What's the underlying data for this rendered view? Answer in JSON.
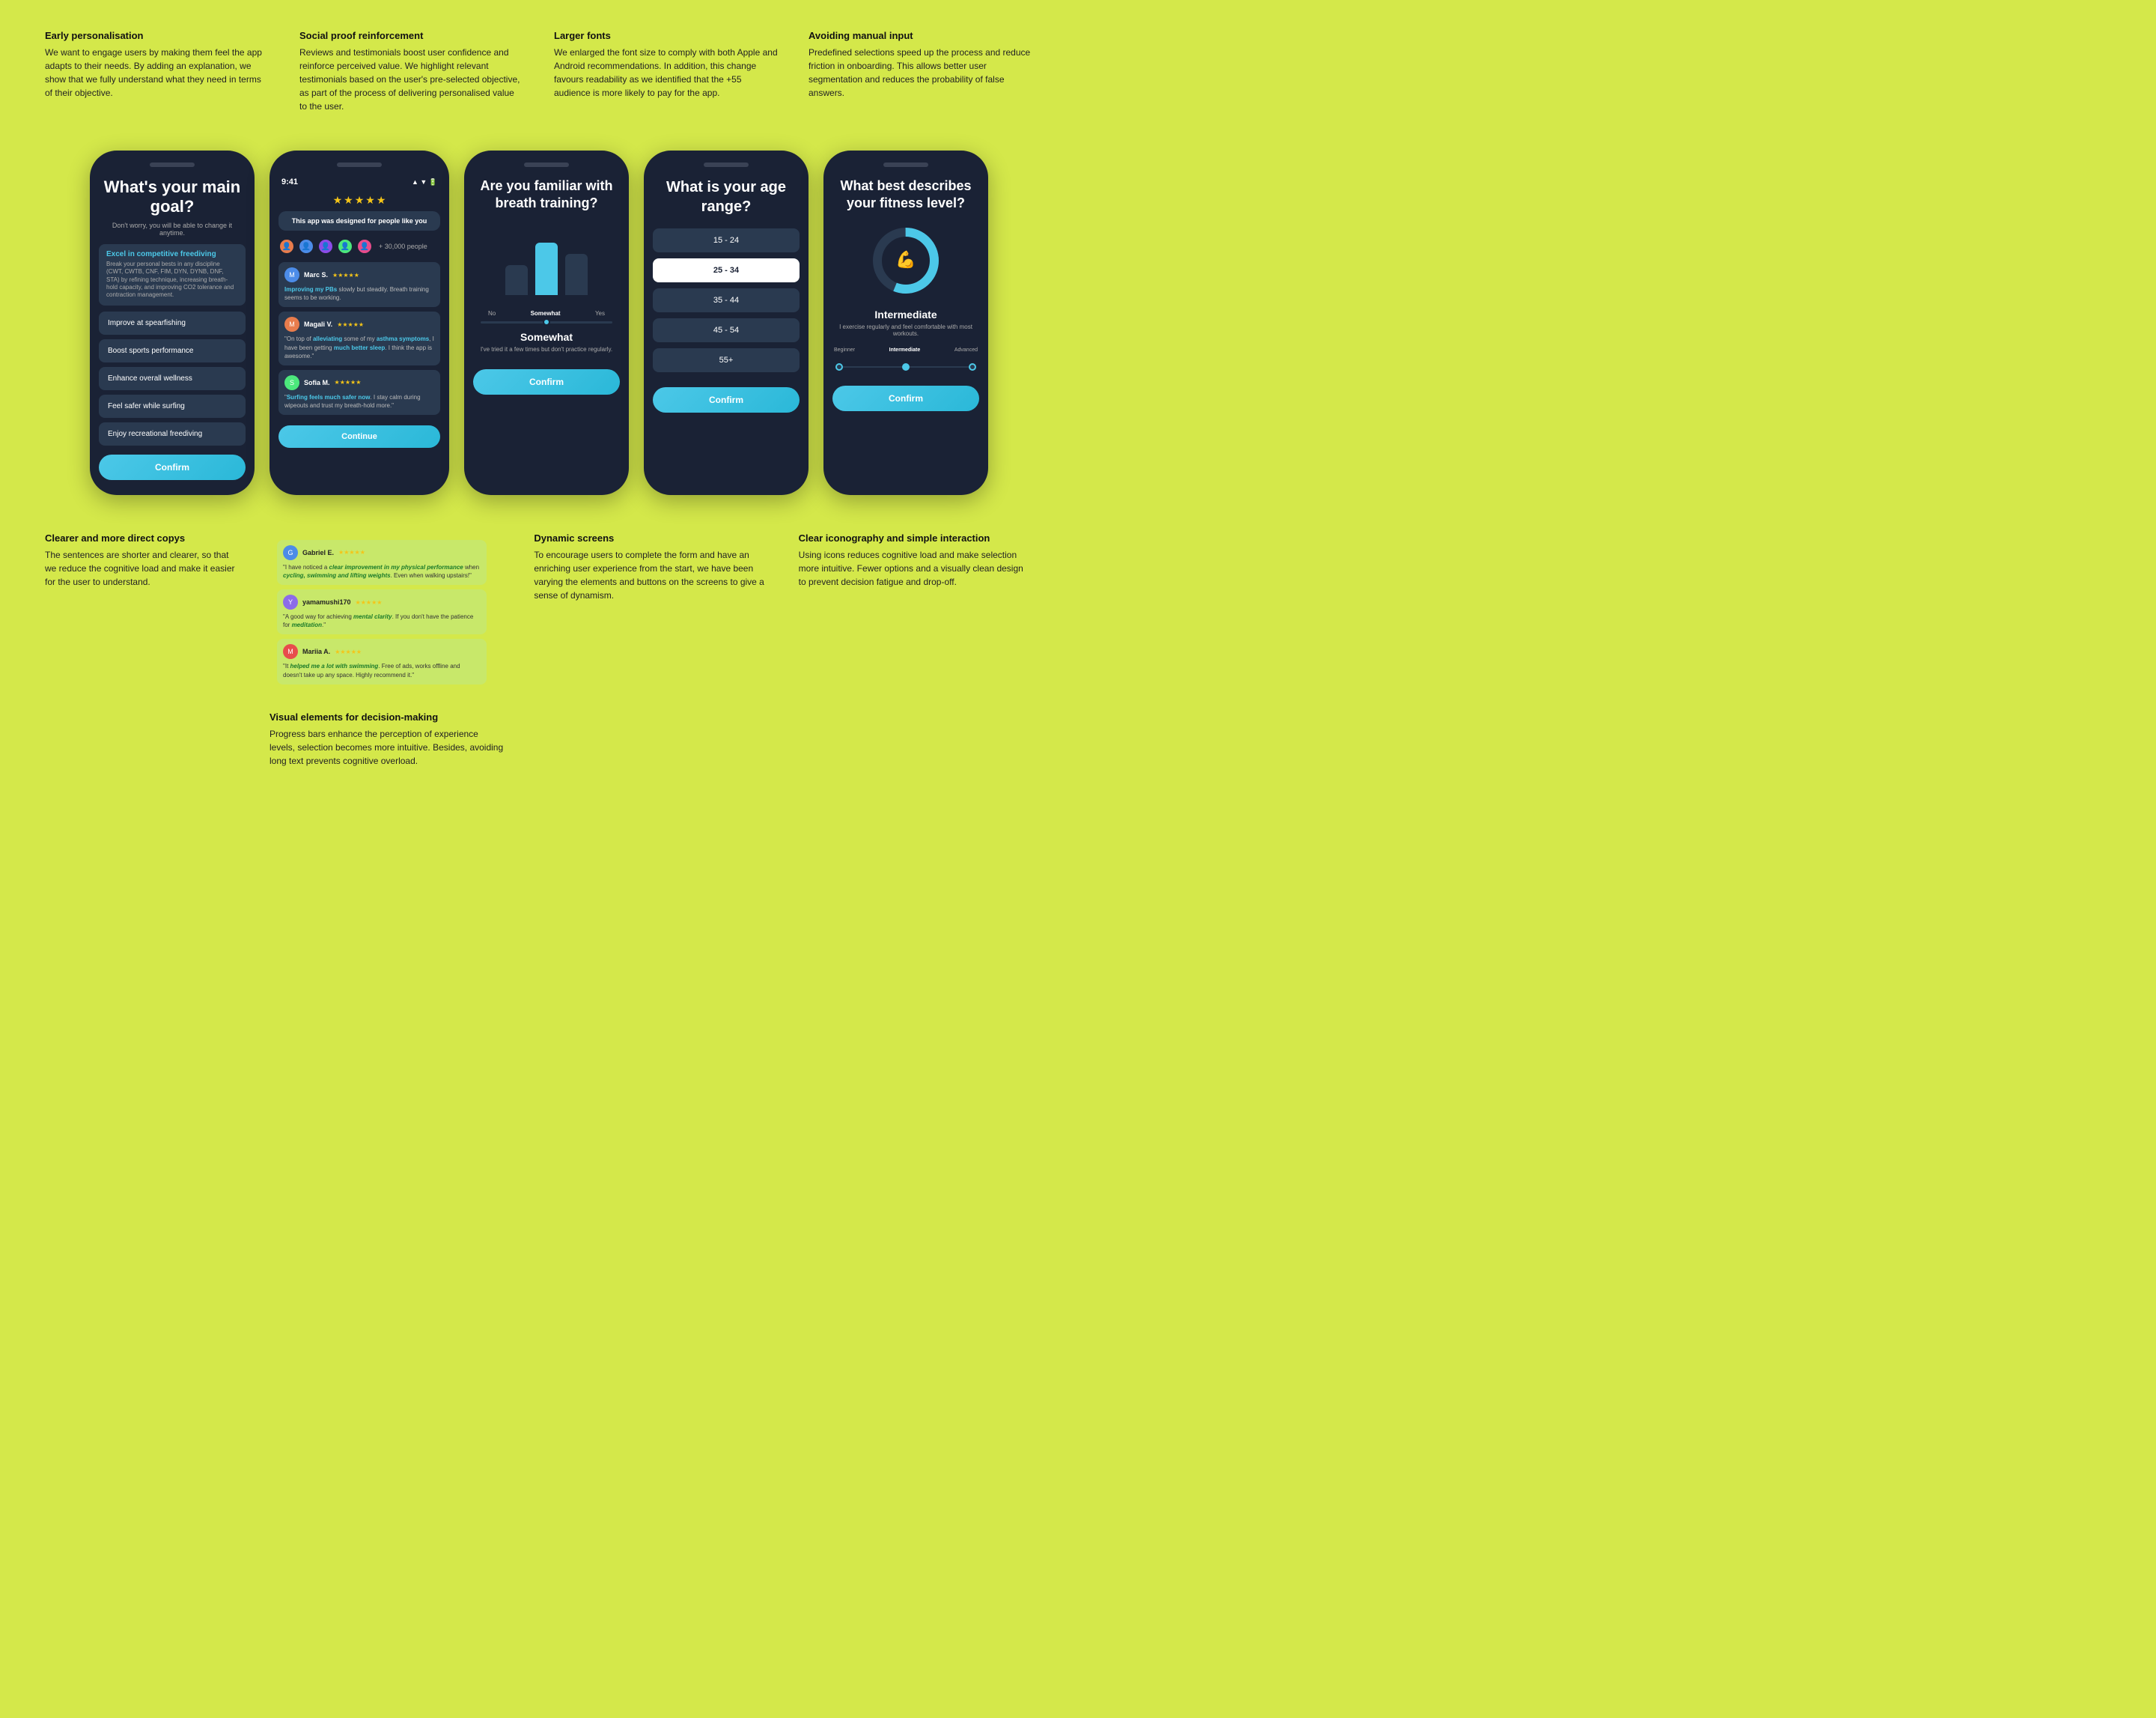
{
  "top_annotations": [
    {
      "id": "early-personalisation",
      "title": "Early personalisation",
      "text": "We want to engage users by making them feel the app adapts to their needs. By adding an explanation, we show that we fully understand what they need in terms of their objective."
    },
    {
      "id": "social-proof",
      "title": "Social proof reinforcement",
      "text": "Reviews and testimonials boost user confidence and reinforce perceived value. We highlight relevant testimonials based on the user's pre-selected objective, as part of the process of delivering personalised value to the user."
    },
    {
      "id": "larger-fonts",
      "title": "Larger fonts",
      "text": "We enlarged the font size to comply with both Apple and Android recommendations. In addition, this change favours readability as we identified that the +55 audience is more likely to pay for the app."
    },
    {
      "id": "avoiding-manual",
      "title": "Avoiding manual input",
      "text": "Predefined selections speed up the process and reduce friction in onboarding. This allows better user segmentation and reduces the probability of false answers."
    }
  ],
  "phone1": {
    "title": "What's your main goal?",
    "subtitle": "Don't worry, you will be able to change it anytime.",
    "selected_option": {
      "title": "Excel in competitive freediving",
      "desc": "Break your personal bests in any discipline (CWT, CWTB, CNF, FIM, DYN, DYNB, DNF, STA) by refining technique, increasing breath-hold capacity, and improving CO2 tolerance and contraction management."
    },
    "options": [
      "Improve at spearfishing",
      "Boost sports performance",
      "Enhance overall wellness",
      "Feel safer while surfing",
      "Enjoy recreational freediving"
    ],
    "confirm_label": "Confirm"
  },
  "phone2": {
    "stars": 5,
    "badge_text": "This app was designed for people like you",
    "avatar_count": "+ 30,000 people",
    "reviews": [
      {
        "name": "Marc S.",
        "stars": 5,
        "text": "\"Improving my PBs slowly but steadily. Breath training seems to be working.\""
      },
      {
        "name": "Magali V.",
        "stars": 5,
        "text": "\"On top of alleviating some of my asthma symptoms, I have been getting much better sleep. I think the app is awesome.\""
      },
      {
        "name": "Sofia M.",
        "stars": 5,
        "text": "\"Surfing feels much safer now. I stay calm during wipeouts and trust my breath-hold more.\""
      }
    ],
    "continue_label": "Continue",
    "extra_reviews": [
      {
        "name": "Gabriel E.",
        "stars": 5,
        "text": "\"I have noticed a clear improvement in my physical performance when cycling, swimming and lifting weights. Even when walking upstairs!\""
      },
      {
        "name": "yamamushi170",
        "stars": 5,
        "text": "\"A good way for achieving mental clarity. If you don't have the patience for meditation.\""
      },
      {
        "name": "Mariia A.",
        "stars": 5,
        "text": "\"It helped me a lot with swimming. Free of ads, works offline and doesn't take up any space. Highly recommend it.\""
      }
    ]
  },
  "phone3": {
    "title": "Are you familiar with breath training?",
    "bars": [
      {
        "label": "No",
        "height_pct": 55,
        "active": false
      },
      {
        "label": "Somewhat",
        "height_pct": 95,
        "active": true
      },
      {
        "label": "Yes",
        "height_pct": 75,
        "active": false
      }
    ],
    "selected": "Somewhat",
    "selected_desc": "I've tried it a few times but don't practice regularly.",
    "confirm_label": "Confirm"
  },
  "phone4": {
    "title": "What is your age range?",
    "options": [
      "15 - 24",
      "25 - 34",
      "35 - 44",
      "45 - 54",
      "55+"
    ],
    "selected": "25 - 34",
    "confirm_label": "Confirm"
  },
  "phone5": {
    "title": "What best describes your fitness level?",
    "level": "Intermediate",
    "desc": "I exercise regularly and feel comfortable with most workouts.",
    "levels": [
      "Beginner",
      "Intermediate",
      "Advanced"
    ],
    "confirm_label": "Confirm"
  },
  "bottom_annotations": [
    {
      "id": "clearer-copy",
      "title": "Clearer and more direct copys",
      "text": "The sentences are shorter and clearer, so that we reduce the cognitive load and make it easier for the user to understand."
    },
    {
      "id": "visual-elements",
      "title": "Visual elements for decision-making",
      "text": "Progress bars enhance the perception of experience levels, selection becomes more intuitive. Besides, avoiding long text prevents cognitive overload."
    },
    {
      "id": "dynamic-screens",
      "title": "Dynamic screens",
      "text": "To encourage users to complete the form and have an enriching user experience from the start, we have been varying the elements and buttons on the screens to give a sense of dynamism."
    },
    {
      "id": "clear-iconography",
      "title": "Clear iconography and simple interaction",
      "text": "Using icons reduces cognitive load and make selection more intuitive. Fewer options and a visually clean design to prevent decision fatigue and drop-off."
    }
  ]
}
